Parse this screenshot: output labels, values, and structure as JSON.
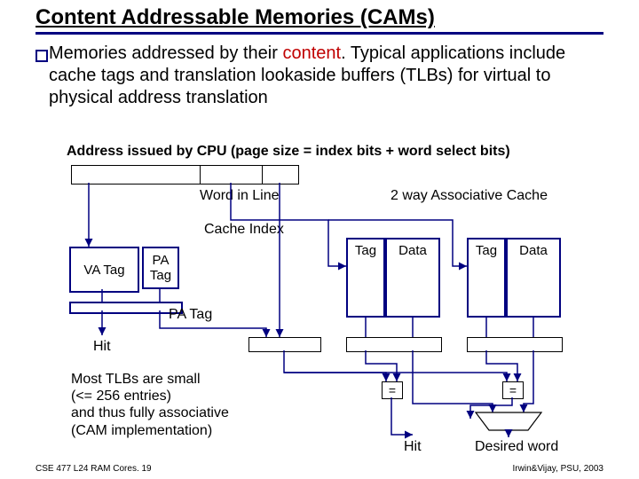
{
  "title": "Content Addressable Memories (CAMs)",
  "bullet": {
    "text1": "Memories addressed by their ",
    "content_word": "content",
    "text2": ".  Typical applications include cache tags and translation lookaside buffers (TLBs) for virtual to physical address translation"
  },
  "captions": {
    "address_issue": "Address issued by CPU (page size = index bits + word select bits)",
    "word_in_line": "Word in Line",
    "assoc_cache": "2 way Associative Cache",
    "cache_index": "Cache Index",
    "pa_tag": "PA Tag",
    "hit_left": "Hit",
    "hit_bottom": "Hit",
    "desired_word": "Desired word"
  },
  "tlb_note": {
    "l1": "Most TLBs are small",
    "l2": "(<= 256 entries)",
    "l3": "and thus fully associative",
    "l4": "(CAM implementation)"
  },
  "boxes": {
    "va_tag": "VA Tag",
    "pa_tag_box_l1": "PA",
    "pa_tag_box_l2": "Tag",
    "tag": "Tag",
    "data": "Data",
    "equals": "="
  },
  "footer": {
    "left": "CSE 477  L24 RAM Cores. 19",
    "right": "Irwin&Vijay, PSU, 2003"
  }
}
